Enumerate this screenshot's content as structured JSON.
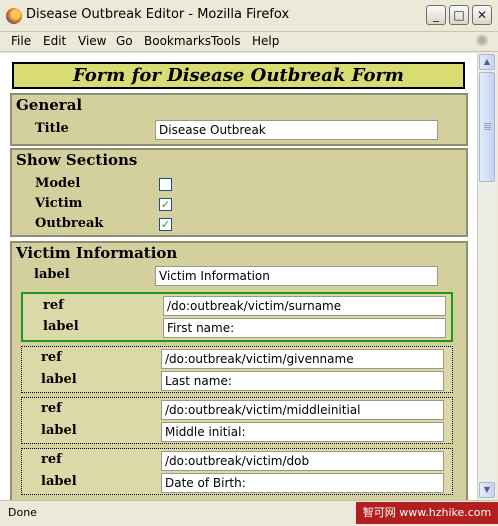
{
  "window": {
    "title": "Disease Outbreak Editor - Mozilla Firefox",
    "controls": {
      "minimize": "_",
      "maximize": "□",
      "close": "✕"
    }
  },
  "menu": [
    "File",
    "Edit",
    "View",
    "Go",
    "Bookmarks",
    "Tools",
    "Help"
  ],
  "form": {
    "header": "Form for Disease Outbreak Form",
    "general": {
      "title": "General",
      "label_title": "Title",
      "title_value": "Disease Outbreak"
    },
    "show_sections": {
      "title": "Show Sections",
      "items": [
        {
          "label": "Model",
          "checked": false
        },
        {
          "label": "Victim",
          "checked": true
        },
        {
          "label": "Outbreak",
          "checked": true
        }
      ]
    },
    "victim_info": {
      "title": "Victim Information",
      "label_label": "label",
      "label_value": "Victim Information",
      "fields": [
        {
          "ref_label": "ref",
          "ref": "/do:outbreak/victim/surname",
          "label_label": "label",
          "label": "First name:"
        },
        {
          "ref_label": "ref",
          "ref": "/do:outbreak/victim/givenname",
          "label_label": "label",
          "label": "Last name:"
        },
        {
          "ref_label": "ref",
          "ref": "/do:outbreak/victim/middleinitial",
          "label_label": "label",
          "label": "Middle initial:"
        },
        {
          "ref_label": "ref",
          "ref": "/do:outbreak/victim/dob",
          "label_label": "label",
          "label": "Date of Birth:"
        }
      ]
    }
  },
  "status": {
    "text": "Done"
  },
  "watermark": "智可网 www.hzhike.com",
  "check_mark": "✓"
}
